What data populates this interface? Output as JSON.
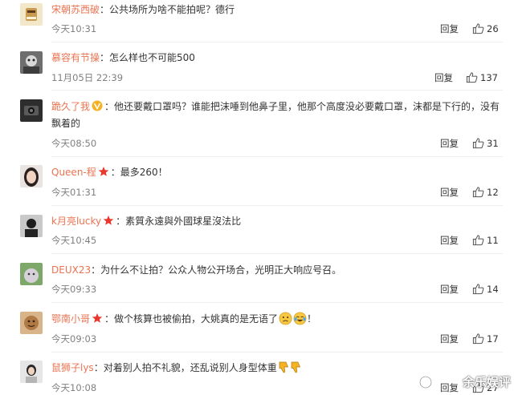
{
  "comments": [
    {
      "user": "宋朝苏西破",
      "badge": "",
      "text": "公共场所为啥不能拍呢？德行",
      "time": "今天10:31",
      "reply": "回复",
      "likes": "26"
    },
    {
      "user": "慕容有节操",
      "badge": "",
      "text": "怎么样也不可能500",
      "time": "11月05日 22:39",
      "reply": "回复",
      "likes": "137"
    },
    {
      "user": "跪久了我",
      "badge": "vip",
      "text": "他还要戴口罩吗？谁能把沫唾到他鼻子里，他那个高度没必要戴口罩，沫都是下行的，没有飘着的",
      "time": "今天08:50",
      "reply": "回复",
      "likes": "31"
    },
    {
      "user": "Queen-程",
      "badge": "star",
      "text": "最多260！",
      "time": "今天01:31",
      "reply": "回复",
      "likes": "12"
    },
    {
      "user": "k月亮lucky",
      "badge": "star",
      "text": "素質永遠與外國球星沒法比",
      "time": "今天10:45",
      "reply": "回复",
      "likes": "11"
    },
    {
      "user": "DEUX23",
      "badge": "",
      "text": "为什么不让拍？公众人物公开场合，光明正大响应号召。",
      "time": "今天09:33",
      "reply": "回复",
      "likes": "14"
    },
    {
      "user": "鄂南小哥",
      "badge": "star",
      "text": "做个核算也被偷拍，大姚真的是无语了",
      "time": "今天09:03",
      "reply": "回复",
      "likes": "17"
    },
    {
      "user": "鼠狮子lys",
      "badge": "",
      "text": "对着别人拍不礼貌，还乱说别人身型体重",
      "time": "今天10:08",
      "reply": "回复",
      "likes": "27"
    }
  ],
  "watermark": "余乐娱评",
  "colors": {
    "username": "#eb7350",
    "time": "#808080",
    "star": "#e8372c",
    "vip": "#f5b323"
  }
}
